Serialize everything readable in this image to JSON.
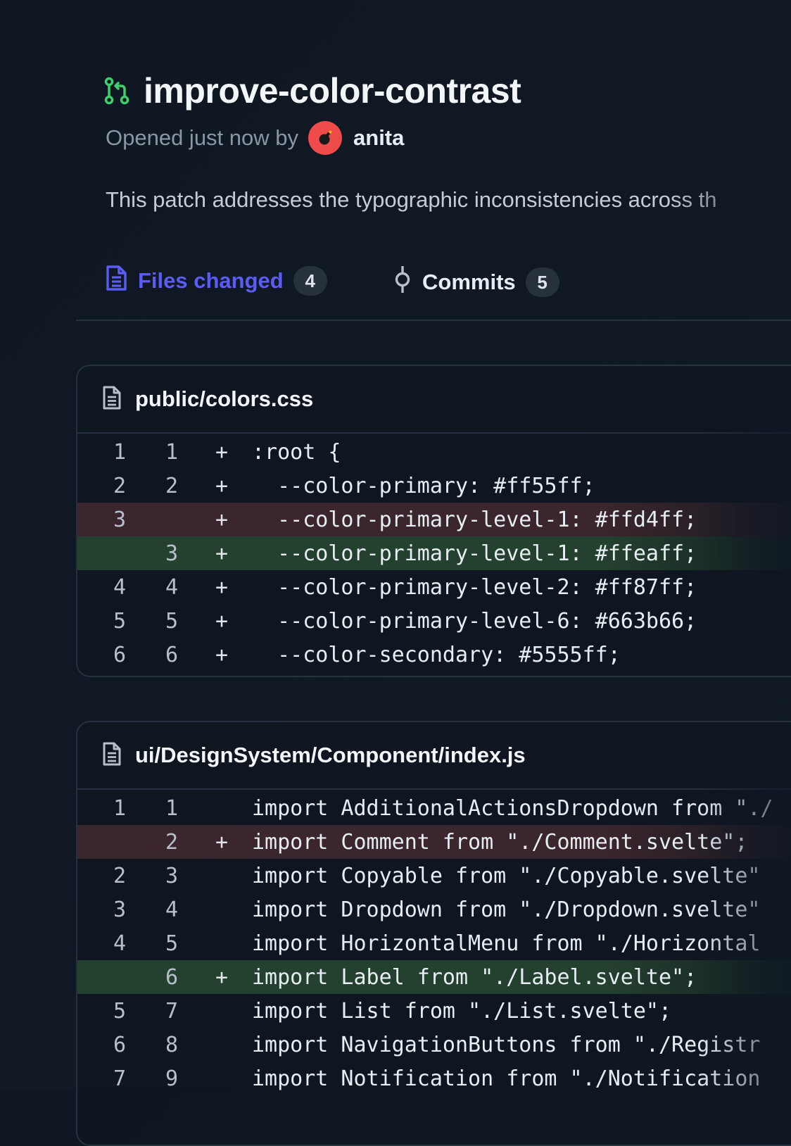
{
  "pr": {
    "title": "improve-color-contrast",
    "opened_prefix": "Opened just now by",
    "author": "anita",
    "description": "This patch addresses the typographic inconsistencies across th"
  },
  "tabs": [
    {
      "label": "Files changed",
      "count": "4",
      "active": true
    },
    {
      "label": "Commits",
      "count": "5",
      "active": false
    }
  ],
  "files": [
    {
      "name": "public/colors.css",
      "lines": [
        {
          "a": "1",
          "b": "1",
          "sign": "+",
          "code": ":root {",
          "type": "context"
        },
        {
          "a": "2",
          "b": "2",
          "sign": "+",
          "code": "  --color-primary: #ff55ff;",
          "type": "context"
        },
        {
          "a": "3",
          "b": "",
          "sign": "+",
          "code": "  --color-primary-level-1: #ffd4ff;",
          "type": "del"
        },
        {
          "a": "",
          "b": "3",
          "sign": "+",
          "code": "  --color-primary-level-1: #ffeaff;",
          "type": "add"
        },
        {
          "a": "4",
          "b": "4",
          "sign": "+",
          "code": "  --color-primary-level-2: #ff87ff;",
          "type": "context"
        },
        {
          "a": "5",
          "b": "5",
          "sign": "+",
          "code": "  --color-primary-level-6: #663b66;",
          "type": "context"
        },
        {
          "a": "6",
          "b": "6",
          "sign": "+",
          "code": "  --color-secondary: #5555ff;",
          "type": "context"
        }
      ]
    },
    {
      "name": "ui/DesignSystem/Component/index.js",
      "lines": [
        {
          "a": "1",
          "b": "1",
          "sign": "",
          "code": "import AdditionalActionsDropdown from \"./",
          "type": "context"
        },
        {
          "a": "",
          "b": "2",
          "sign": "+",
          "code": "import Comment from \"./Comment.svelte\";",
          "type": "del"
        },
        {
          "a": "2",
          "b": "3",
          "sign": "",
          "code": "import Copyable from \"./Copyable.svelte\"",
          "type": "context"
        },
        {
          "a": "3",
          "b": "4",
          "sign": "",
          "code": "import Dropdown from \"./Dropdown.svelte\"",
          "type": "context"
        },
        {
          "a": "4",
          "b": "5",
          "sign": "",
          "code": "import HorizontalMenu from \"./Horizontal",
          "type": "context"
        },
        {
          "a": "",
          "b": "6",
          "sign": "+",
          "code": "import Label from \"./Label.svelte\";",
          "type": "add"
        },
        {
          "a": "5",
          "b": "7",
          "sign": "",
          "code": "import List from \"./List.svelte\";",
          "type": "context"
        },
        {
          "a": "6",
          "b": "8",
          "sign": "",
          "code": "import NavigationButtons from \"./Registr",
          "type": "context"
        },
        {
          "a": "7",
          "b": "9",
          "sign": "",
          "code": "import Notification from \"./Notification",
          "type": "context"
        }
      ]
    }
  ],
  "colors": {
    "background": "#0f1722",
    "accent": "#5b5cf6",
    "branch_icon": "#3ecf6b",
    "avatar": "#ef4b4b",
    "deleted_row": "#3a262c",
    "added_row": "#24402e"
  },
  "icons": {
    "branch": "git-pull-request-icon",
    "files_tab": "file-document-icon",
    "commits_tab": "git-commit-icon",
    "file_header": "file-document-icon"
  }
}
